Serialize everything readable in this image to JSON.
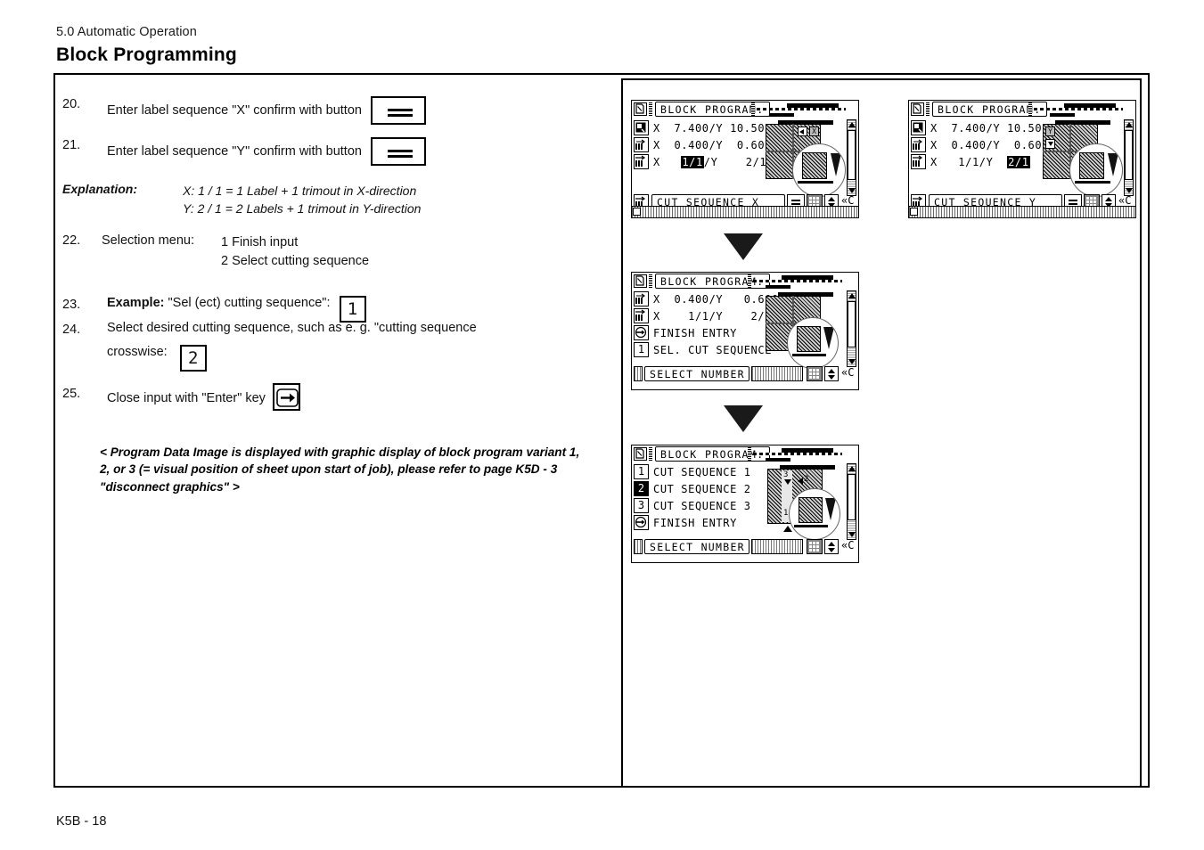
{
  "header": {
    "section": "5.0 Automatic Operation",
    "title": "Block Programming"
  },
  "footer": {
    "page": "K5B - 18"
  },
  "steps": [
    {
      "num": "20.",
      "text": "Enter label sequence \"X\" confirm with button",
      "key": "equals-key"
    },
    {
      "num": "21.",
      "text": "Enter label sequence \"Y\" confirm with button",
      "key": "equals-key"
    }
  ],
  "explanation": {
    "label": "Explanation:",
    "line1": "X: 1 / 1 = 1 Label + 1 trimout in X-direction",
    "line2": "Y: 2 / 1 = 2 Labels + 1 trimout in Y-direction"
  },
  "selection_menu": {
    "num": "22.",
    "label": "Selection menu:",
    "option1": "1 Finish input",
    "option2": "2 Select cutting sequence"
  },
  "step23": {
    "num": "23.",
    "bold": "Example:",
    "text": "\"Sel (ect) cutting sequence\":",
    "key": "1"
  },
  "step24": {
    "num": "24.",
    "line1": "Select desired cutting sequence, such as e. g. \"cutting sequence",
    "line2": "crosswise:",
    "key": "2"
  },
  "step25": {
    "num": "25.",
    "text": "Close input with \"Enter\" key",
    "key": "enter-key"
  },
  "note": "< Program Data Image is displayed with graphic display of block program variant 1, 2, or 3 (= visual position of sheet upon start of job), please refer to page K5D - 3 \"disconnect graphics\" >",
  "screens": [
    {
      "id": "screen-cut-sequence-x",
      "title": "BLOCK PROGRAM.",
      "rows": [
        {
          "icon": "sheet-format-icon",
          "text": "X  7.400/Y 10.500",
          "highlight": null
        },
        {
          "icon": "label-size-icon",
          "text": "X  0.400/Y  0.600",
          "highlight": null
        },
        {
          "icon": "cut-sequence-icon",
          "pre": "X   ",
          "hl": "1/1",
          "post": "/Y    2/1"
        }
      ],
      "status": {
        "icon": "cut-sequence-icon",
        "field": "CUT SEQUENCE X"
      }
    },
    {
      "id": "screen-cut-sequence-y",
      "title": "BLOCK PROGRAM.",
      "rows": [
        {
          "icon": "sheet-format-icon",
          "text": "X  7.400/Y 10.500",
          "highlight": null
        },
        {
          "icon": "label-size-icon",
          "text": "X  0.400/Y  0.600",
          "highlight": null
        },
        {
          "icon": "cut-sequence-icon",
          "pre": "X   1/1/Y  ",
          "hl": "2/1",
          "post": ""
        }
      ],
      "status": {
        "icon": "cut-sequence-icon",
        "field": "CUT SEQUENCE Y"
      }
    },
    {
      "id": "screen-select-number-entry",
      "title": "BLOCK PROGRAM.",
      "rows": [
        {
          "icon": "label-size-icon",
          "text": "X  0.400/Y   0.600"
        },
        {
          "icon": "cut-sequence-icon",
          "text": "X    1/1/Y    2/1"
        },
        {
          "icon": "enter-icon",
          "text": "FINISH ENTRY"
        },
        {
          "icon": "key-1",
          "text": "SEL. CUT SEQUENCE"
        }
      ],
      "status": {
        "icon": null,
        "field": "SELECT NUMBER"
      }
    },
    {
      "id": "screen-select-cut-sequence",
      "title": "BLOCK PROGRAM.",
      "rows": [
        {
          "icon": "key-1",
          "text": "CUT SEQUENCE 1",
          "selected": false
        },
        {
          "icon": "key-2",
          "text": "CUT SEQUENCE 2",
          "selected": true
        },
        {
          "icon": "key-3",
          "text": "CUT SEQUENCE 3",
          "selected": false
        },
        {
          "icon": "enter-icon",
          "text": "FINISH ENTRY",
          "selected": false
        }
      ],
      "status": {
        "icon": null,
        "field": "SELECT NUMBER"
      },
      "graphic_labels": [
        "3",
        "2",
        "1"
      ]
    }
  ],
  "colors": {
    "ink": "#000000",
    "paper": "#ffffff",
    "sheet_fill": "#cfcfcf",
    "arrow": "#1a1a1a"
  }
}
